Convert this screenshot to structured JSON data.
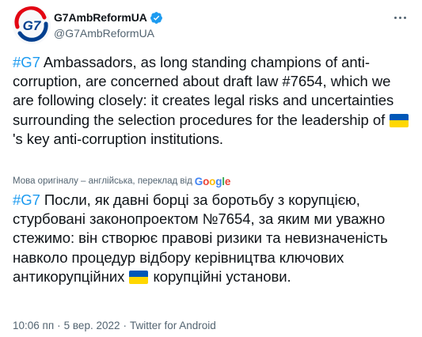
{
  "author": {
    "display_name": "G7AmbReformUA",
    "handle": "@G7AmbReformUA",
    "verified": true,
    "avatar_text": "G7"
  },
  "tweet": {
    "original": {
      "hashtag": "#G7",
      "text_before_flag": " Ambassadors, as long standing champions of anti-corruption, are concerned about draft law #7654, which we are following closely: it creates legal risks and uncertainties surrounding the selection procedures for the leadership of ",
      "flag_icon": "ukraine-flag-icon",
      "text_after_flag": "'s key anti-corruption institutions."
    },
    "translation_note": {
      "label": "Мова оригіналу – англійська, переклад від",
      "provider": "Google"
    },
    "translated": {
      "hashtag": "#G7",
      "text_before_flag": " Посли, як давні борці за боротьбу з корупцією, стурбовані законопроектом №7654, за яким ми уважно стежимо: він створює правові ризики та невизначеність навколо процедур відбору керівництва ключових антикорупційних ",
      "flag_icon": "ukraine-flag-icon",
      "text_after_flag": " корупційні установи."
    }
  },
  "meta": {
    "time": "10:06 пп",
    "date": "5 вер. 2022",
    "separator": "·",
    "source": "Twitter for Android"
  },
  "colors": {
    "link": "#1d9bf0",
    "text": "#0f1419",
    "secondary": "#536471",
    "verified_badge": "#1d9bf0",
    "avatar_red": "#e30613",
    "avatar_blue": "#003f8f",
    "flag_blue": "#0057b7",
    "flag_yellow": "#ffd700"
  }
}
